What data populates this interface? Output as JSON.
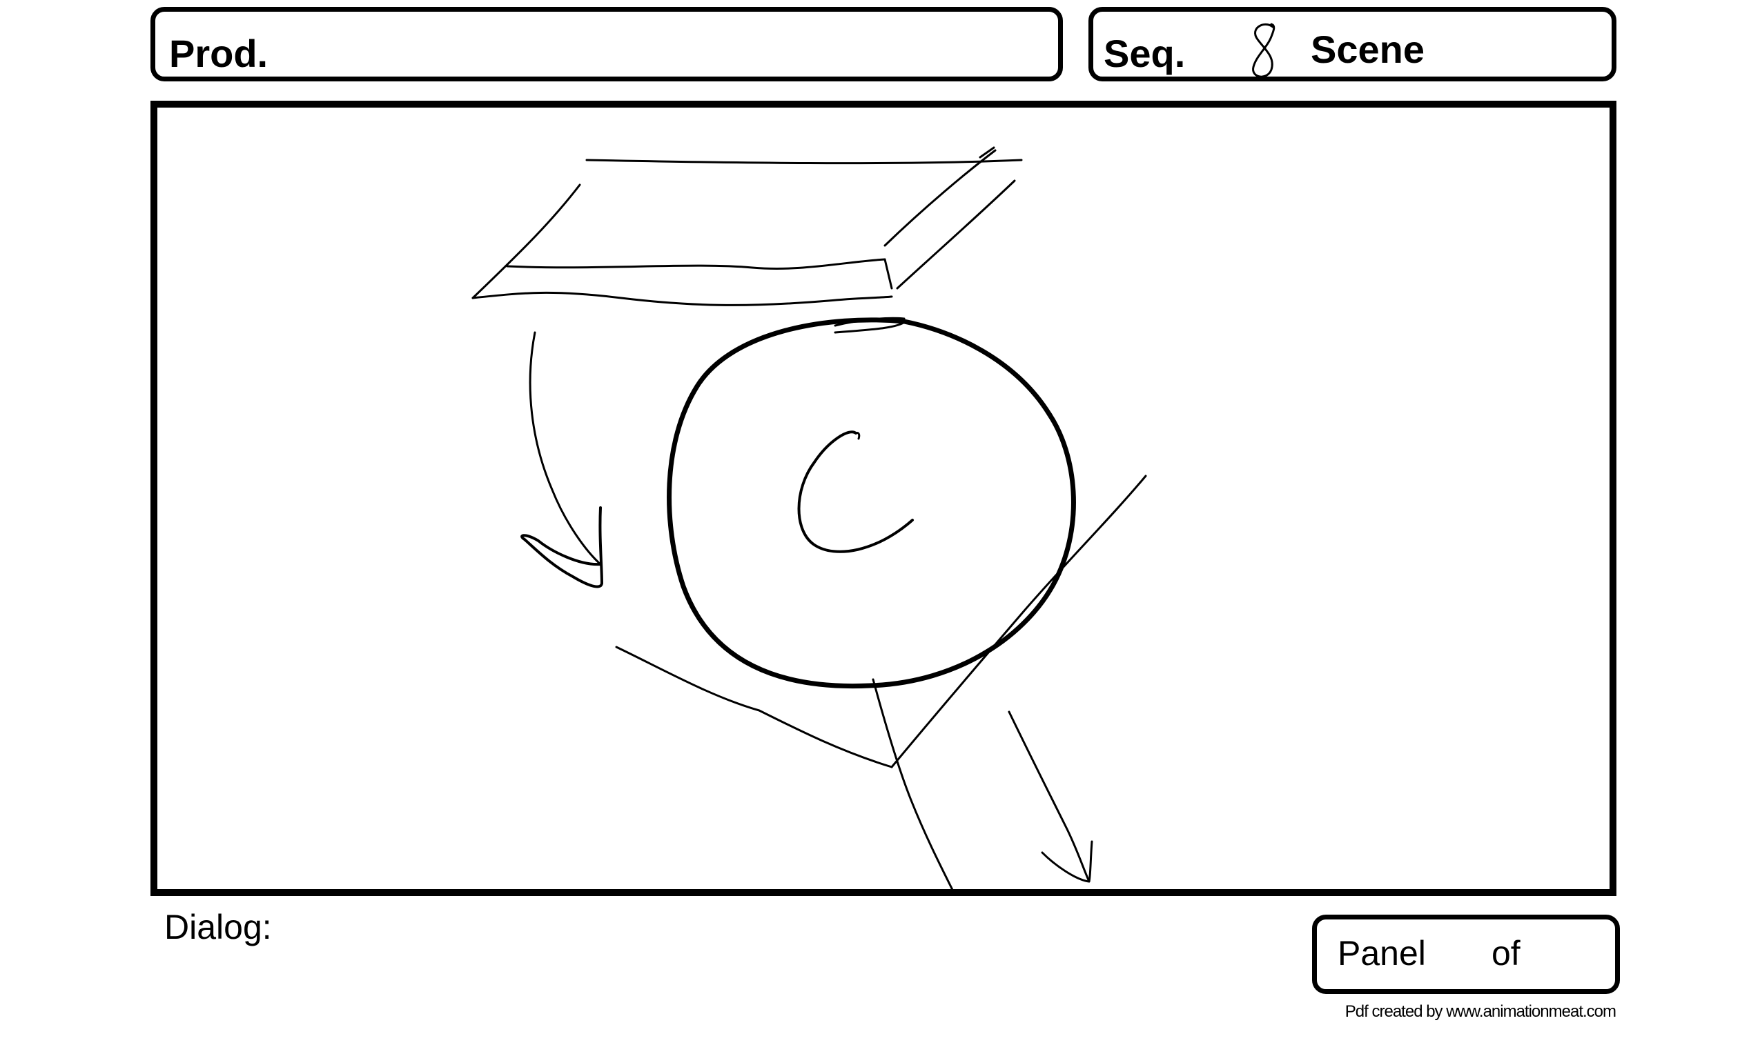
{
  "header": {
    "prod_label": "Prod.",
    "seq_label": "Seq.",
    "seq_value": "8",
    "scene_label": "Scene"
  },
  "frame": {
    "sketch": "hand-drawn-storyboard-sketch"
  },
  "footer": {
    "dialog_label": "Dialog:",
    "panel_label": "Panel",
    "of_label": "of",
    "credit": "Pdf created by www.animationmeat.com"
  },
  "colors": {
    "ink": "#000000",
    "paper": "#ffffff"
  }
}
